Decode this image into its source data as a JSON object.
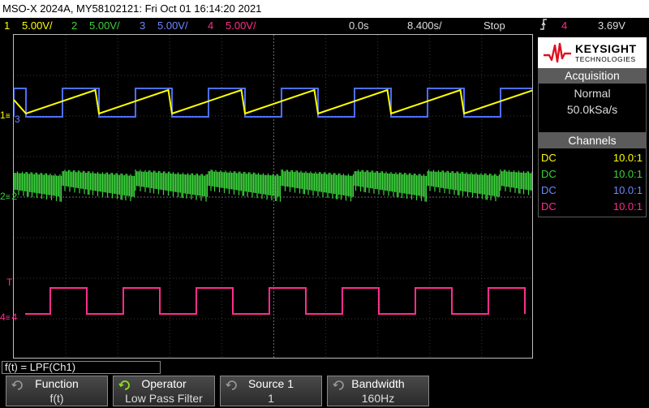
{
  "title": "MSO-X 2024A, MY58102121: Fri Oct 01 16:14:20 2021",
  "status": {
    "ch1_scale": "5.00V/",
    "ch2_scale": "5.00V/",
    "ch3_scale": "5.00V/",
    "ch4_scale": "5.00V/",
    "ch1_num": "1",
    "ch2_num": "2",
    "ch3_num": "3",
    "ch4_num": "4",
    "time_delay": "0.0s",
    "timebase": "8.400s/",
    "run_state": "Stop",
    "trigger_source": "4",
    "trigger_level": "3.69V"
  },
  "colors": {
    "ch1": "#ffff00",
    "ch2": "#3cd23c",
    "ch3": "#4d6eff",
    "ch4": "#ff2d8c",
    "trigger": "#ff8a1a",
    "panel": "#5b5b5b"
  },
  "markers": {
    "ch1": "1",
    "ch3": "3",
    "ch2": "2",
    "ch4": "4",
    "trig": "T"
  },
  "logo": {
    "brand": "KEYSIGHT",
    "tagline": "TECHNOLOGIES"
  },
  "acquisition": {
    "heading": "Acquisition",
    "mode": "Normal",
    "rate": "50.0kSa/s"
  },
  "channels": {
    "heading": "Channels",
    "rows": [
      {
        "coupling": "DC",
        "ratio": "10.0:1"
      },
      {
        "coupling": "DC",
        "ratio": "10.0:1"
      },
      {
        "coupling": "DC",
        "ratio": "10.0:1"
      },
      {
        "coupling": "DC",
        "ratio": "10.0:1"
      }
    ]
  },
  "function_bar": "f(t) = LPF(Ch1)",
  "softkeys": [
    {
      "title": "Function",
      "value": "f(t)",
      "icon": "rotary-knob-icon"
    },
    {
      "title": "Operator",
      "value": "Low Pass Filter",
      "icon": "rotary-knob-icon"
    },
    {
      "title": "Source 1",
      "value": "1",
      "icon": "rotary-knob-icon"
    },
    {
      "title": "Bandwidth",
      "value": "160Hz",
      "icon": "rotary-knob-icon"
    }
  ]
}
